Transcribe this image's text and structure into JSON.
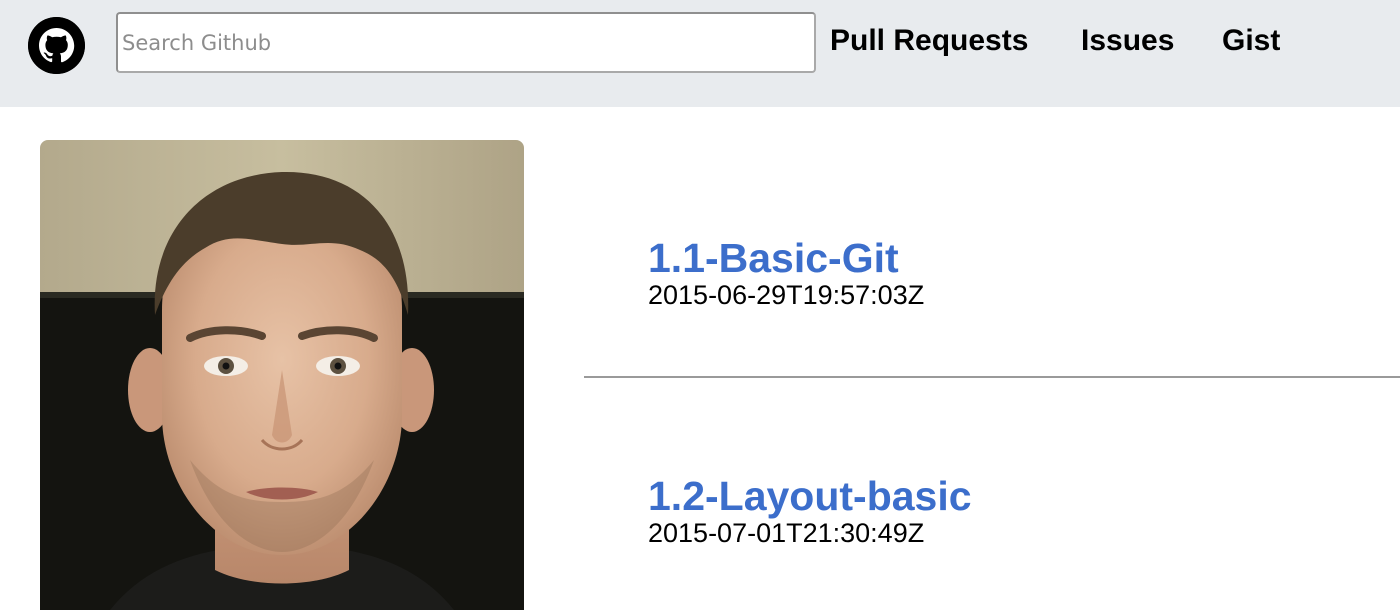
{
  "header": {
    "logo_icon": "github-octocat-icon",
    "search": {
      "placeholder": "Search Github",
      "value": ""
    },
    "nav": [
      {
        "label": "Pull Requests"
      },
      {
        "label": "Issues"
      },
      {
        "label": "Gist"
      }
    ],
    "background_color": "#e8ebee"
  },
  "profile": {
    "avatar": "user-avatar-photo"
  },
  "repos": [
    {
      "name": "1.1-Basic-Git",
      "updated": "2015-06-29T19:57:03Z"
    },
    {
      "name": "1.2-Layout-basic",
      "updated": "2015-07-01T21:30:49Z"
    }
  ],
  "colors": {
    "link": "#3c6ecb",
    "divider": "#9a9a9a"
  }
}
